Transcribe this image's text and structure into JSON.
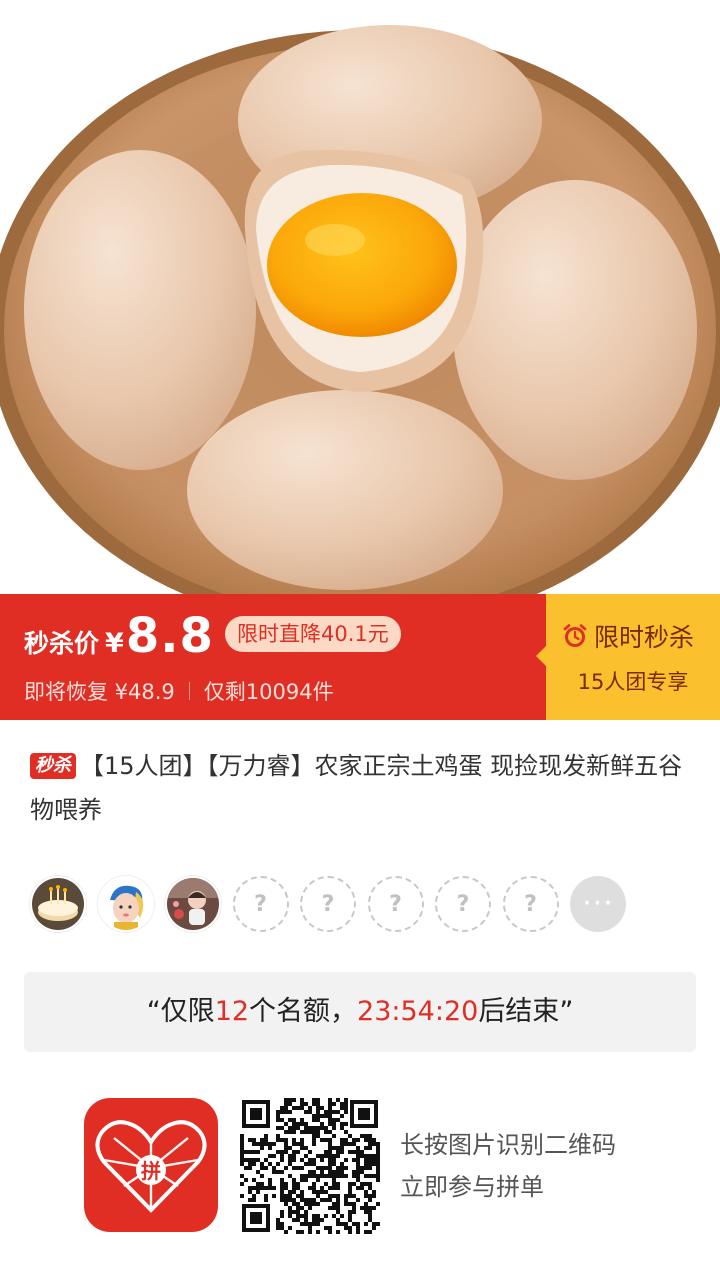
{
  "product": {
    "image": "eggs-in-wooden-bowl",
    "badge": "秒杀",
    "title": "【15人团】【万力睿】农家正宗土鸡蛋 现捡现发新鲜五谷物喂养"
  },
  "price_banner": {
    "label": "秒杀价",
    "currency": "¥",
    "price": "8.8",
    "drop_text": "限时直降40.1元",
    "restore_text": "即将恢复 ¥48.9",
    "stock_text": "仅剩10094件",
    "flash_title": "限时秒杀",
    "group_text": "15人团专享",
    "colors": {
      "banner_red": "#e02e24",
      "banner_yellow": "#fbc02d"
    }
  },
  "group": {
    "avatars": [
      {
        "type": "photo",
        "name": "avatar-cake"
      },
      {
        "type": "photo",
        "name": "avatar-girl-turban"
      },
      {
        "type": "photo",
        "name": "avatar-figurine"
      },
      {
        "type": "empty",
        "symbol": "?"
      },
      {
        "type": "empty",
        "symbol": "?"
      },
      {
        "type": "empty",
        "symbol": "?"
      },
      {
        "type": "empty",
        "symbol": "?"
      },
      {
        "type": "empty",
        "symbol": "?"
      },
      {
        "type": "more",
        "symbol": "···"
      }
    ]
  },
  "quota": {
    "open_quote": "“",
    "prefix": "仅限",
    "count": "12",
    "mid": "个名额，",
    "countdown": "23:54:20",
    "suffix": "后结束",
    "close_quote": "”"
  },
  "footer": {
    "logo_text": "拼",
    "line1": "长按图片识别二维码",
    "line2": "立即参与拼单"
  }
}
